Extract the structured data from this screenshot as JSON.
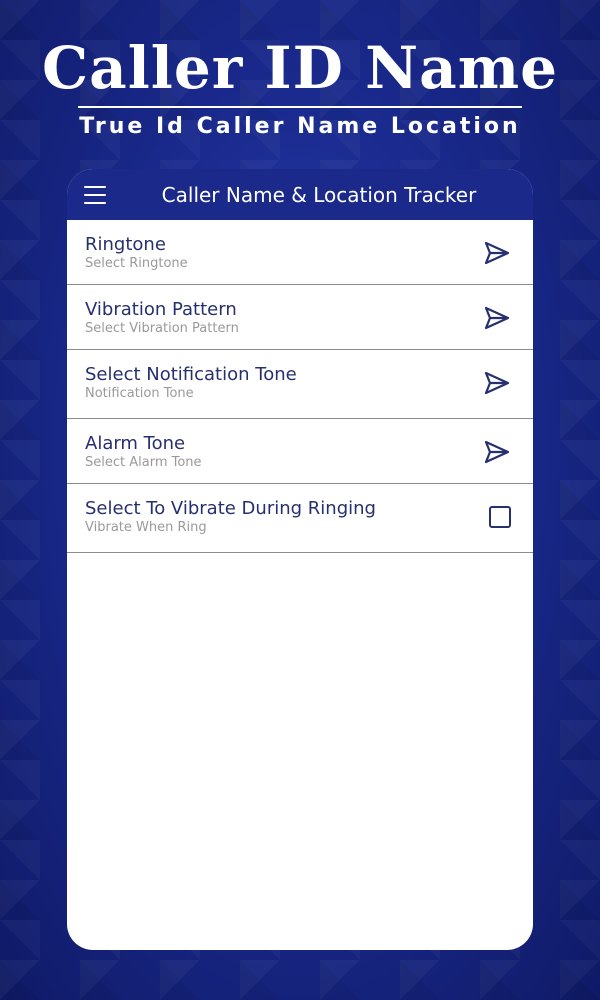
{
  "header": {
    "title": "Caller ID Name",
    "subtitle": "True Id Caller Name Location"
  },
  "toolbar": {
    "title": "Caller Name & Location Tracker",
    "menu_icon": "hamburger-menu-icon"
  },
  "settings": {
    "items": [
      {
        "title": "Ringtone",
        "subtitle": "Select Ringtone",
        "icon": "send-arrow-icon"
      },
      {
        "title": "Vibration Pattern",
        "subtitle": "Select Vibration Pattern",
        "icon": "send-arrow-icon"
      },
      {
        "title": "Select Notification Tone",
        "subtitle": "Notification Tone",
        "icon": "send-arrow-icon"
      },
      {
        "title": "Alarm Tone",
        "subtitle": "Select Alarm Tone",
        "icon": "send-arrow-icon"
      }
    ],
    "vibrate": {
      "title": "Select To Vibrate During Ringing",
      "subtitle": "Vibrate When Ring",
      "checked": false
    }
  },
  "colors": {
    "background": "#1a2a8e",
    "toolbar": "#1b2a8a",
    "item_title": "#27306e",
    "item_subtitle": "#9a9a9a",
    "icon": "#27306e"
  }
}
